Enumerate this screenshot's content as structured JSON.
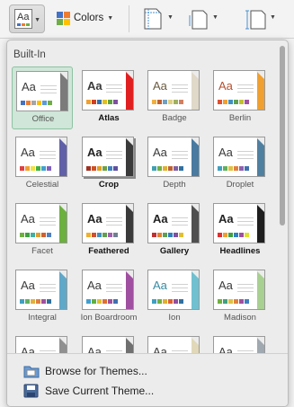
{
  "ribbon": {
    "themes_icon_text": "Aa",
    "colors_label": "Colors"
  },
  "gallery": {
    "section_title": "Built-In",
    "themes": [
      {
        "name": "Office",
        "bold": false,
        "selected": true,
        "accent": "#7b7b7b",
        "font_color": "#3a3a3a",
        "swatches": [
          "#4472c4",
          "#ed7d31",
          "#a5a5a5",
          "#ffc000",
          "#5b9bd5",
          "#70ad47"
        ]
      },
      {
        "name": "Atlas",
        "bold": true,
        "selected": false,
        "accent": "#e02020",
        "font_color": "#3a3a3a",
        "swatches": [
          "#f0a030",
          "#d04020",
          "#3070b0",
          "#e0c020",
          "#60a040",
          "#8050a0"
        ]
      },
      {
        "name": "Badge",
        "bold": false,
        "selected": false,
        "accent": "#e0d8c8",
        "font_color": "#6a5a40",
        "swatches": [
          "#f0b040",
          "#c06030",
          "#70a0c0",
          "#e0d080",
          "#a0b060",
          "#d08060"
        ]
      },
      {
        "name": "Berlin",
        "bold": false,
        "selected": false,
        "accent": "#f0a030",
        "font_color": "#b05030",
        "swatches": [
          "#e05030",
          "#f0a030",
          "#4090c0",
          "#60a050",
          "#c0c030",
          "#a050a0"
        ]
      },
      {
        "name": "Celestial",
        "bold": false,
        "selected": false,
        "accent": "#6060a8",
        "font_color": "#3a3a3a",
        "swatches": [
          "#e04040",
          "#f0a030",
          "#f0e040",
          "#40b040",
          "#40a0d0",
          "#8060c0"
        ]
      },
      {
        "name": "Crop",
        "bold": true,
        "selected": false,
        "accent": "#3a3a3a",
        "font_color": "#222222",
        "swatches": [
          "#a03020",
          "#d05020",
          "#e0a020",
          "#70a040",
          "#4080c0",
          "#6050a0"
        ]
      },
      {
        "name": "Depth",
        "bold": false,
        "selected": false,
        "accent": "#4a7aa0",
        "font_color": "#3a3a3a",
        "swatches": [
          "#40a0b0",
          "#70b040",
          "#e0b030",
          "#c06030",
          "#8060a0",
          "#3070a0"
        ]
      },
      {
        "name": "Droplet",
        "bold": false,
        "selected": false,
        "accent": "#5080a0",
        "font_color": "#3a3a3a",
        "swatches": [
          "#40a0c0",
          "#60b060",
          "#e0c040",
          "#e08040",
          "#9060b0",
          "#4070b0"
        ]
      },
      {
        "name": "Facet",
        "bold": false,
        "selected": false,
        "accent": "#6cb040",
        "font_color": "#3a3a3a",
        "swatches": [
          "#70b040",
          "#40a040",
          "#40b0a0",
          "#e0a030",
          "#d06030",
          "#5080c0"
        ]
      },
      {
        "name": "Feathered",
        "bold": true,
        "selected": false,
        "accent": "#3a3a3a",
        "font_color": "#222222",
        "swatches": [
          "#f0b030",
          "#d05030",
          "#4090c0",
          "#60a050",
          "#a060b0",
          "#708090"
        ]
      },
      {
        "name": "Gallery",
        "bold": true,
        "selected": false,
        "accent": "#505050",
        "font_color": "#222222",
        "swatches": [
          "#c03030",
          "#e08030",
          "#60a050",
          "#3080c0",
          "#8050a0",
          "#e0c030"
        ]
      },
      {
        "name": "Headlines",
        "bold": true,
        "selected": false,
        "accent": "#1e1e1e",
        "font_color": "#222222",
        "swatches": [
          "#e03030",
          "#f0a030",
          "#40a040",
          "#3080c0",
          "#a050a0",
          "#e0e030"
        ]
      },
      {
        "name": "Integral",
        "bold": false,
        "selected": false,
        "accent": "#60a8c8",
        "font_color": "#3a3a3a",
        "swatches": [
          "#40a0c0",
          "#60b060",
          "#e0b040",
          "#e08040",
          "#a050a0",
          "#3070a0"
        ]
      },
      {
        "name": "Ion Boardroom",
        "bold": false,
        "selected": false,
        "accent": "#a050a0",
        "font_color": "#3a3a3a",
        "swatches": [
          "#40a0d0",
          "#60b040",
          "#e0c030",
          "#e07030",
          "#a050a0",
          "#4070b0"
        ]
      },
      {
        "name": "Ion",
        "bold": false,
        "selected": false,
        "accent": "#70c0d0",
        "font_color": "#3a8aa0",
        "swatches": [
          "#40a0c0",
          "#70b040",
          "#e0b030",
          "#e06030",
          "#9050a0",
          "#3070a0"
        ]
      },
      {
        "name": "Madison",
        "bold": false,
        "selected": false,
        "accent": "#a8d090",
        "font_color": "#3a3a3a",
        "swatches": [
          "#70b040",
          "#40a080",
          "#e0c040",
          "#e08040",
          "#a050a0",
          "#4080c0"
        ]
      },
      {
        "name": "",
        "bold": false,
        "selected": false,
        "accent": "#909090",
        "font_color": "#3a3a3a",
        "swatches": []
      },
      {
        "name": "",
        "bold": false,
        "selected": false,
        "accent": "#707070",
        "font_color": "#3a3a3a",
        "swatches": []
      },
      {
        "name": "",
        "bold": false,
        "selected": false,
        "accent": "#e0d8b8",
        "font_color": "#3a3a3a",
        "swatches": []
      },
      {
        "name": "",
        "bold": false,
        "selected": false,
        "accent": "#a0a8b0",
        "font_color": "#3a3a3a",
        "swatches": []
      }
    ]
  },
  "footer": {
    "browse_label": "Browse for Themes...",
    "save_label": "Save Current Theme..."
  },
  "colors": {
    "selected_bg": "#cfe6d8",
    "panel_bg": "#ececec"
  }
}
